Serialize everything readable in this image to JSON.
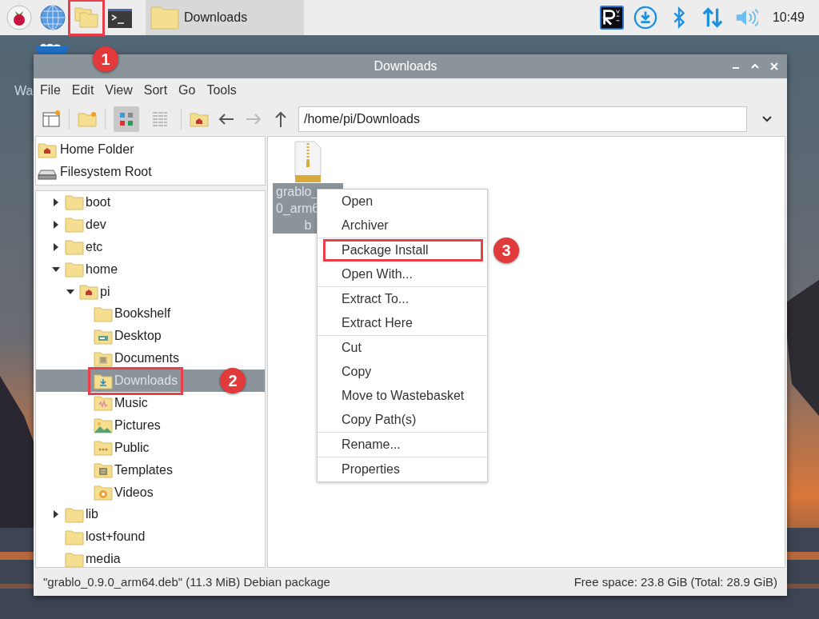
{
  "taskbar": {
    "launchers": [
      {
        "kind": "raspberry"
      },
      {
        "kind": "browser"
      },
      {
        "kind": "files",
        "badge": "1"
      },
      {
        "kind": "terminal"
      }
    ],
    "task": {
      "label": "Downloads"
    },
    "tray": [
      {
        "kind": "vnc"
      },
      {
        "kind": "download"
      },
      {
        "kind": "bluetooth"
      },
      {
        "kind": "network"
      },
      {
        "kind": "volume"
      }
    ],
    "clock": "10:49"
  },
  "desktop": {
    "icon_label": "Wa"
  },
  "window": {
    "title": "Downloads",
    "menu": [
      "File",
      "Edit",
      "View",
      "Sort",
      "Go",
      "Tools"
    ],
    "toolbar": [
      {
        "kind": "new-window"
      },
      {
        "kind": "sep"
      },
      {
        "kind": "new-folder"
      },
      {
        "kind": "sep"
      },
      {
        "kind": "icon-view",
        "selected": true
      },
      {
        "kind": "list-view",
        "selected": false
      },
      {
        "kind": "sep"
      },
      {
        "kind": "home"
      },
      {
        "kind": "back",
        "disabled": false
      },
      {
        "kind": "forward",
        "disabled": true
      },
      {
        "kind": "up",
        "disabled": false
      }
    ],
    "path": "/home/pi/Downloads",
    "places": [
      {
        "label": "Home Folder",
        "kind": "home"
      },
      {
        "label": "Filesystem Root",
        "kind": "drive"
      }
    ],
    "tree": [
      {
        "label": "boot",
        "kind": "folder",
        "expanded": false,
        "selected": false
      },
      {
        "label": "dev",
        "kind": "folder",
        "expanded": false,
        "selected": false
      },
      {
        "label": "etc",
        "kind": "folder",
        "expanded": false,
        "selected": false
      },
      {
        "label": "home",
        "kind": "folder",
        "expanded": true,
        "selected": false,
        "children": [
          {
            "label": "pi",
            "kind": "home",
            "expanded": true,
            "selected": false,
            "children": [
              {
                "label": "Bookshelf",
                "kind": "folder",
                "selected": false
              },
              {
                "label": "Desktop",
                "kind": "desktop",
                "selected": false
              },
              {
                "label": "Documents",
                "kind": "documents",
                "selected": false
              },
              {
                "label": "Downloads",
                "kind": "downloads",
                "selected": true,
                "badge": "2"
              },
              {
                "label": "Music",
                "kind": "music",
                "selected": false
              },
              {
                "label": "Pictures",
                "kind": "pictures",
                "selected": false
              },
              {
                "label": "Public",
                "kind": "public",
                "selected": false
              },
              {
                "label": "Templates",
                "kind": "templates",
                "selected": false
              },
              {
                "label": "Videos",
                "kind": "videos",
                "selected": false
              }
            ]
          }
        ]
      },
      {
        "label": "lib",
        "kind": "folder",
        "expanded": false,
        "selected": false
      },
      {
        "label": "lost+found",
        "kind": "folder",
        "selected": false
      },
      {
        "label": "media",
        "kind": "folder",
        "selected": false
      }
    ],
    "files": [
      {
        "label_lines": [
          "grablo_",
          "0_arm6",
          "b"
        ],
        "kind": "archive",
        "selected": true
      }
    ],
    "context_menu": [
      [
        {
          "label": "Open"
        },
        {
          "label": "Archiver"
        }
      ],
      [
        {
          "label": "Package Install",
          "badge": "3"
        },
        {
          "label": "Open With..."
        }
      ],
      [
        {
          "label": "Extract To..."
        },
        {
          "label": "Extract Here"
        }
      ],
      [
        {
          "label": "Cut"
        },
        {
          "label": "Copy"
        },
        {
          "label": "Move to Wastebasket"
        },
        {
          "label": "Copy Path(s)"
        }
      ],
      [
        {
          "label": "Rename..."
        }
      ],
      [
        {
          "label": "Properties"
        }
      ]
    ],
    "status_bar": {
      "left": "\"grablo_0.9.0_arm64.deb\" (11.3 MiB) Debian package",
      "right": "Free space: 23.8 GiB (Total: 28.9 GiB)"
    }
  }
}
